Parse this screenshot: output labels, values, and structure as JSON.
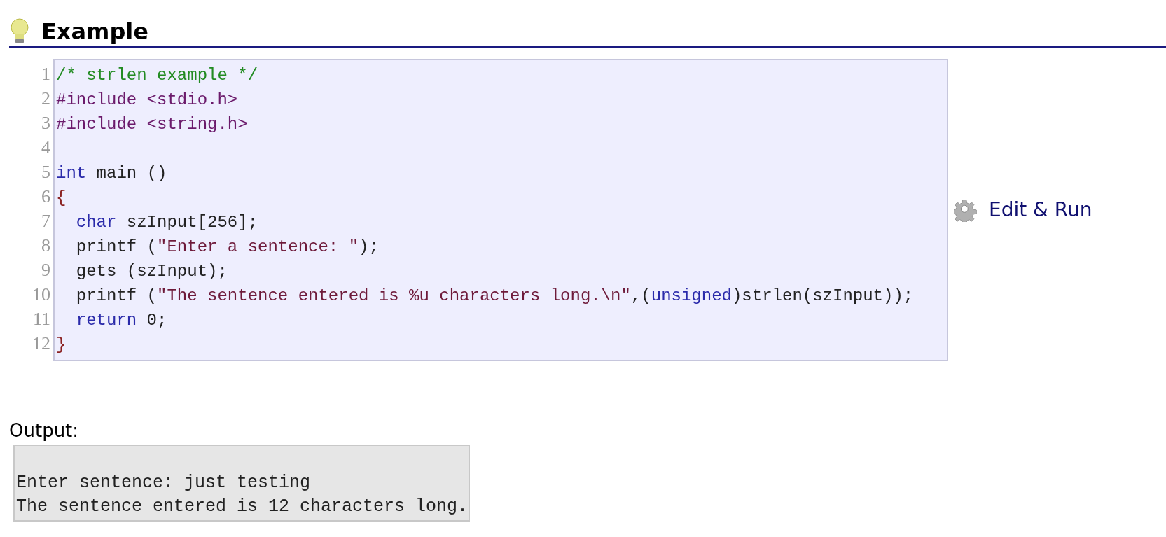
{
  "section": {
    "title": "Example"
  },
  "code": {
    "lines": [
      {
        "number": "1",
        "tokens": [
          {
            "kind": "comment",
            "text": "/* strlen example */"
          }
        ]
      },
      {
        "number": "2",
        "tokens": [
          {
            "kind": "preproc",
            "text": "#include <stdio.h>"
          }
        ]
      },
      {
        "number": "3",
        "tokens": [
          {
            "kind": "preproc",
            "text": "#include <string.h>"
          }
        ]
      },
      {
        "number": "4"
      },
      {
        "number": "5",
        "tokens": [
          {
            "kind": "keyword",
            "text": "int"
          },
          {
            "kind": "plain",
            "text": " main ()"
          }
        ]
      },
      {
        "number": "6",
        "tokens": [
          {
            "kind": "brace",
            "text": "{"
          }
        ]
      },
      {
        "number": "7",
        "indented": true,
        "tokens": [
          {
            "kind": "keyword",
            "text": "char"
          },
          {
            "kind": "plain",
            "text": " szInput[256];"
          }
        ]
      },
      {
        "number": "8",
        "indented": true,
        "tokens": [
          {
            "kind": "plain",
            "text": "printf ("
          },
          {
            "kind": "string",
            "text": "\"Enter a sentence: \""
          },
          {
            "kind": "plain",
            "text": ");"
          }
        ]
      },
      {
        "number": "9",
        "indented": true,
        "tokens": [
          {
            "kind": "plain",
            "text": "gets (szInput);"
          }
        ]
      },
      {
        "number": "10",
        "indented": true,
        "tokens": [
          {
            "kind": "plain",
            "text": "printf ("
          },
          {
            "kind": "string",
            "text": "\"The sentence entered is %u characters long.\\n\""
          },
          {
            "kind": "plain",
            "text": ",("
          },
          {
            "kind": "keyword",
            "text": "unsigned"
          },
          {
            "kind": "plain",
            "text": ")strlen(szInput));"
          }
        ]
      },
      {
        "number": "11",
        "indented": true,
        "tokens": [
          {
            "kind": "keyword",
            "text": "return"
          },
          {
            "kind": "plain",
            "text": " 0;"
          }
        ]
      },
      {
        "number": "12",
        "tokens": [
          {
            "kind": "brace",
            "text": "}"
          }
        ]
      }
    ]
  },
  "edit_run": {
    "label": "Edit & Run"
  },
  "output": {
    "label": "Output:",
    "lines": [
      "Enter sentence: just testing",
      "The sentence entered is 12 characters long."
    ]
  }
}
